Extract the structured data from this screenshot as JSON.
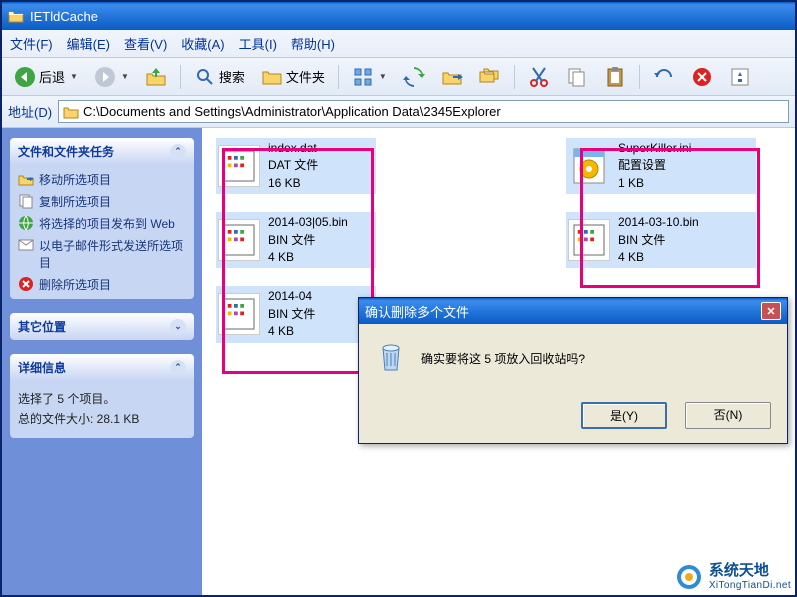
{
  "window": {
    "title": "IETldCache"
  },
  "menu": {
    "file": "文件(F)",
    "edit": "编辑(E)",
    "view": "查看(V)",
    "favorites": "收藏(A)",
    "tools": "工具(I)",
    "help": "帮助(H)"
  },
  "toolbar": {
    "back": "后退",
    "search": "搜索",
    "folders": "文件夹"
  },
  "address": {
    "label": "地址(D)",
    "path": "C:\\Documents and Settings\\Administrator\\Application Data\\2345Explorer"
  },
  "sidebar": {
    "tasks_title": "文件和文件夹任务",
    "tasks": [
      "移动所选项目",
      "复制所选项目",
      "将选择的项目发布到 Web",
      "以电子邮件形式发送所选项目",
      "删除所选项目"
    ],
    "other_title": "其它位置",
    "details_title": "详细信息",
    "details_line1": "选择了 5 个项目。",
    "details_line2": "总的文件大小: 28.1 KB"
  },
  "files": [
    {
      "name": "index.dat",
      "type": "DAT 文件",
      "size": "16 KB"
    },
    {
      "name": "2014-03|05.bin",
      "type": "BIN 文件",
      "size": "4 KB"
    },
    {
      "name": "2014-04",
      "type": "BIN 文件",
      "size": "4 KB"
    },
    {
      "name": "SuperKiller.ini",
      "type": "配置设置",
      "size": "1 KB"
    },
    {
      "name": "2014-03-10.bin",
      "type": "BIN 文件",
      "size": "4 KB"
    }
  ],
  "dialog": {
    "title": "确认删除多个文件",
    "message": "确实要将这 5 项放入回收站吗?",
    "yes": "是(Y)",
    "no": "否(N)"
  },
  "watermark": {
    "big": "系统天地",
    "small": "XiTongTianDi.net"
  },
  "colors": {
    "accent": "#e6007e",
    "titlebar": "#0a5bc4",
    "sidebar": "#6f8fd8"
  }
}
